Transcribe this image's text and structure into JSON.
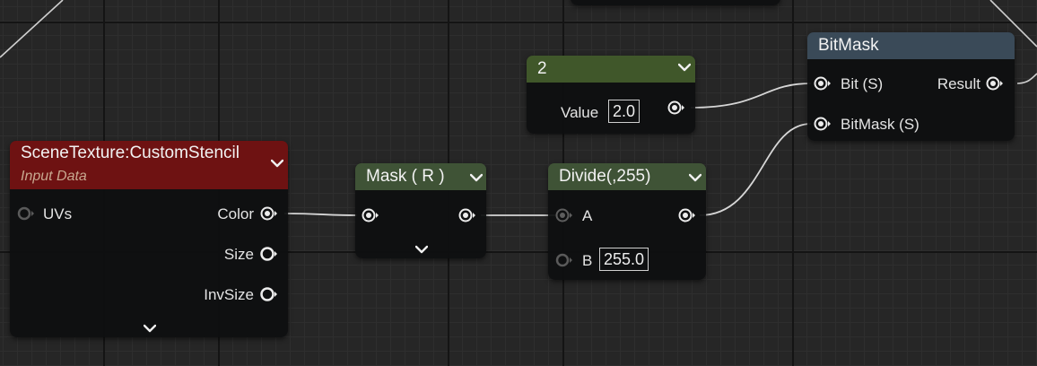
{
  "nodes": {
    "scene_texture": {
      "title": "SceneTexture:CustomStencil",
      "subtitle": "Input Data",
      "header_color": "#6e1212",
      "pins": {
        "uvs": "UVs",
        "color": "Color",
        "size": "Size",
        "invsize": "InvSize"
      }
    },
    "mask": {
      "title": "Mask ( R )",
      "header_color": "#3f5336"
    },
    "divide": {
      "title": "Divide(,255)",
      "header_color": "#3f5336",
      "pins": {
        "a": "A",
        "b": "B"
      },
      "b_value": "255.0"
    },
    "constant": {
      "title": "2",
      "header_color": "#40572a",
      "value_label": "Value",
      "value": "2.0"
    },
    "bitmask": {
      "title": "BitMask",
      "header_color": "#3a4a58",
      "pins": {
        "bit": "Bit (S)",
        "bitmask": "BitMask (S)",
        "result": "Result"
      }
    }
  },
  "icons": {
    "pin_connected": "filled-ring-pin",
    "pin_unconnected": "hollow-ring-pin",
    "collapse": "chevron-down-icon"
  }
}
